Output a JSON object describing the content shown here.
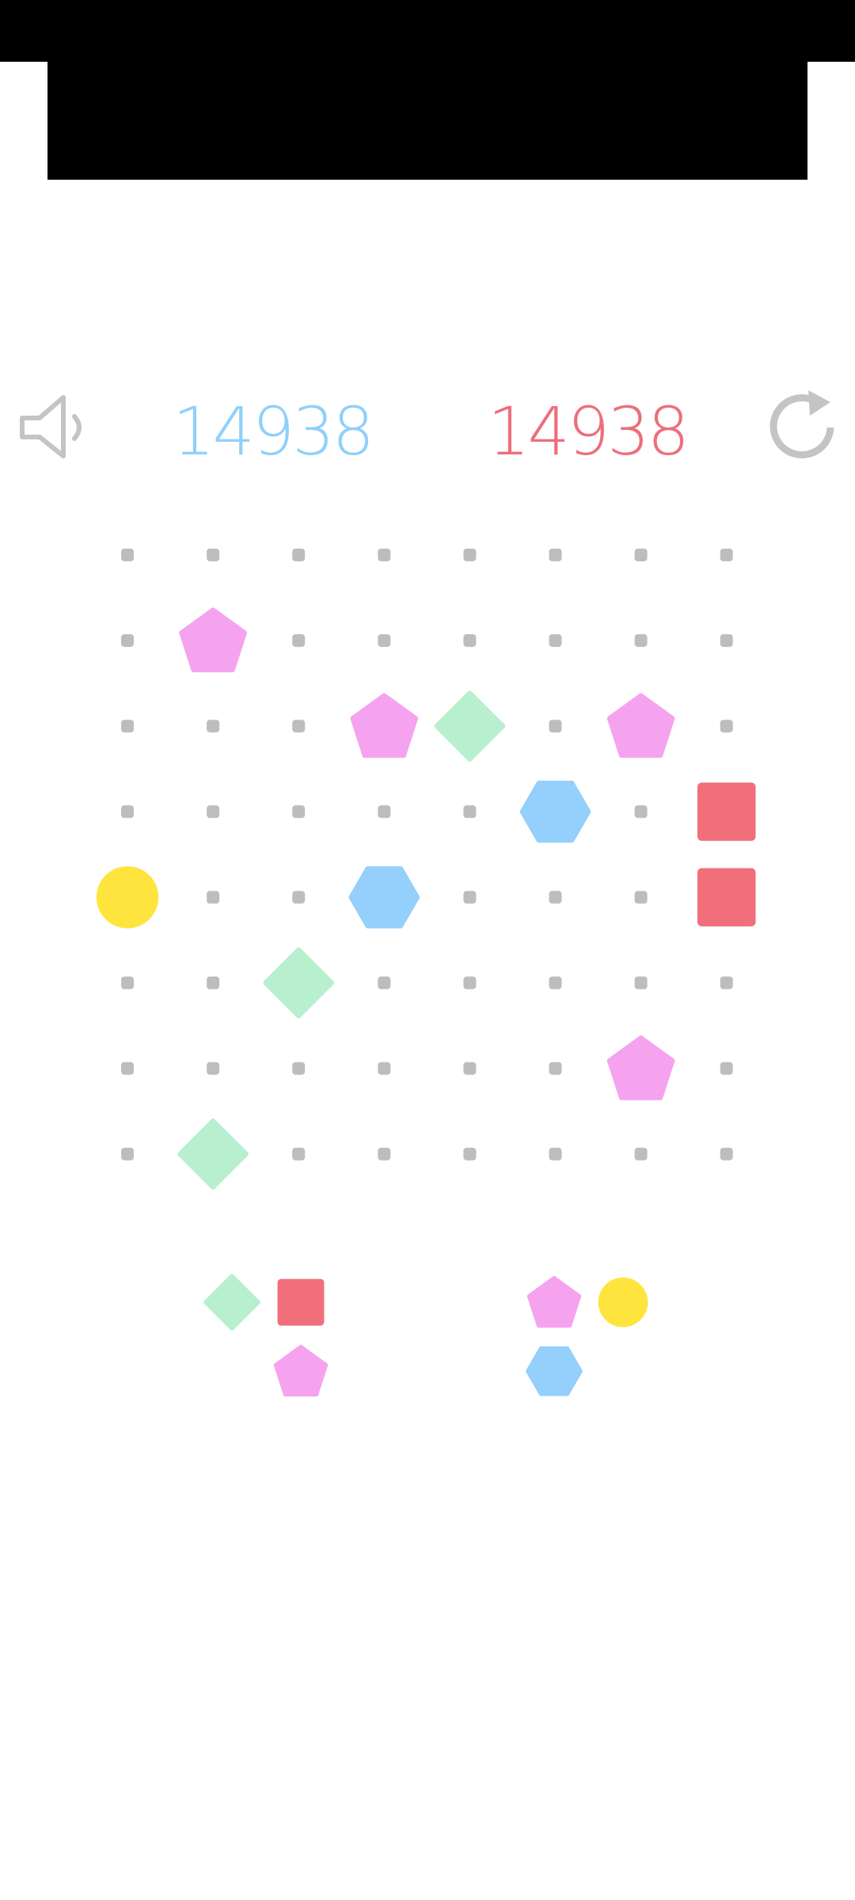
{
  "header": {
    "current_score": "14938",
    "best_score": "14938",
    "sound_icon": "speaker-muted-icon",
    "restart_icon": "restart-icon"
  },
  "colors": {
    "current_score": "#8fd0fb",
    "best_score": "#ec6f7b",
    "dot": "#bdbdbd",
    "pink": "#f5a3ef",
    "green": "#b8f0cf",
    "blue": "#95cffb",
    "red": "#f06f7b",
    "yellow": "#ffe43e"
  },
  "board": {
    "rows": 8,
    "cols": 8,
    "pieces": [
      {
        "row": 1,
        "col": 1,
        "shape": "pentagon",
        "color": "pink"
      },
      {
        "row": 2,
        "col": 3,
        "shape": "pentagon",
        "color": "pink"
      },
      {
        "row": 2,
        "col": 4,
        "shape": "diamond",
        "color": "green"
      },
      {
        "row": 2,
        "col": 6,
        "shape": "pentagon",
        "color": "pink"
      },
      {
        "row": 3,
        "col": 5,
        "shape": "hexagon",
        "color": "blue"
      },
      {
        "row": 3,
        "col": 7,
        "shape": "square",
        "color": "red"
      },
      {
        "row": 4,
        "col": 0,
        "shape": "circle",
        "color": "yellow"
      },
      {
        "row": 4,
        "col": 3,
        "shape": "hexagon",
        "color": "blue"
      },
      {
        "row": 4,
        "col": 7,
        "shape": "square",
        "color": "red"
      },
      {
        "row": 5,
        "col": 2,
        "shape": "diamond",
        "color": "green"
      },
      {
        "row": 6,
        "col": 6,
        "shape": "pentagon",
        "color": "pink"
      },
      {
        "row": 7,
        "col": 1,
        "shape": "diamond",
        "color": "green"
      }
    ]
  },
  "tray": [
    {
      "name": "tray-piece-left",
      "blocks": [
        {
          "row": 0,
          "col": 0,
          "shape": "diamond",
          "color": "green"
        },
        {
          "row": 0,
          "col": 1,
          "shape": "square",
          "color": "red"
        },
        {
          "row": 1,
          "col": 1,
          "shape": "pentagon",
          "color": "pink"
        }
      ]
    },
    {
      "name": "tray-piece-right",
      "blocks": [
        {
          "row": 0,
          "col": 0,
          "shape": "pentagon",
          "color": "pink"
        },
        {
          "row": 0,
          "col": 1,
          "shape": "circle",
          "color": "yellow"
        },
        {
          "row": 1,
          "col": 0,
          "shape": "hexagon",
          "color": "blue"
        }
      ]
    }
  ]
}
